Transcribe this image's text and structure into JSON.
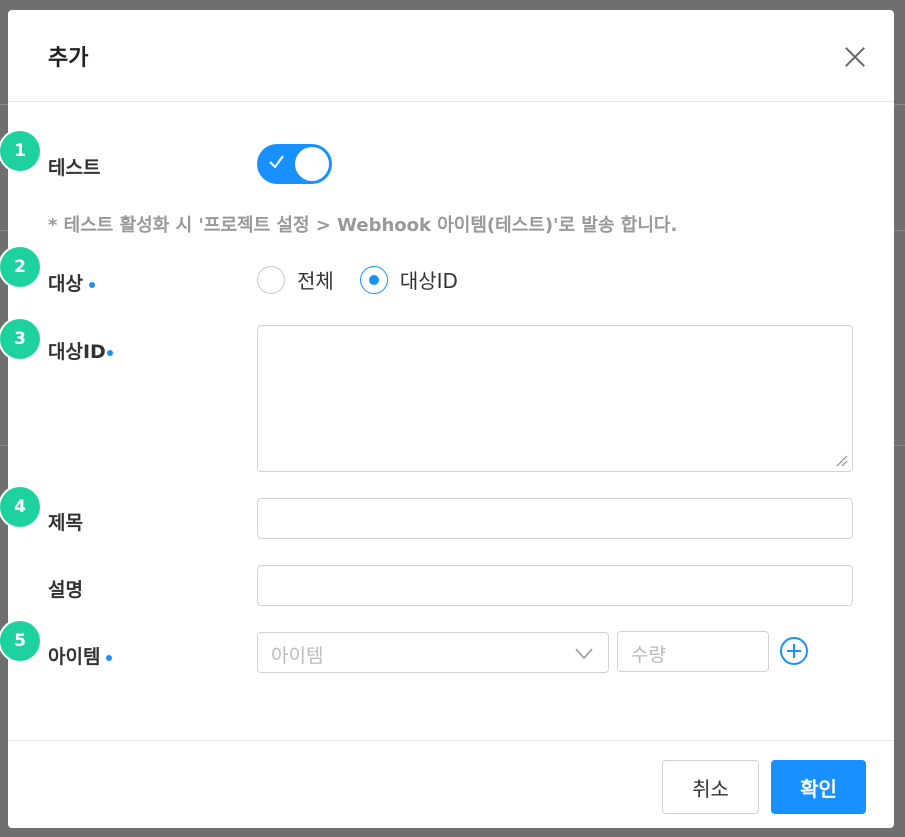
{
  "modal": {
    "title": "추가"
  },
  "badges": [
    "1",
    "2",
    "3",
    "4",
    "5"
  ],
  "fields": {
    "test_label": "테스트",
    "test_enabled": true,
    "hint": "* 테스트 활성화 시 '프로젝트 설정 > Webhook 아이템(테스트)'로 발송 합니다.",
    "target_label": "대상",
    "target_options": [
      "전체",
      "대상ID"
    ],
    "target_selected": "대상ID",
    "target_id_label": "대상ID",
    "target_id_value": "",
    "subject_label": "제목",
    "subject_value": "",
    "description_label": "설명",
    "description_value": "",
    "item_label": "아이템",
    "item_select_placeholder": "아이템",
    "quantity_placeholder": "수량"
  },
  "footer": {
    "cancel_label": "취소",
    "ok_label": "확인"
  },
  "colors": {
    "accent": "#1890ff",
    "badge": "#1ed2a0"
  }
}
